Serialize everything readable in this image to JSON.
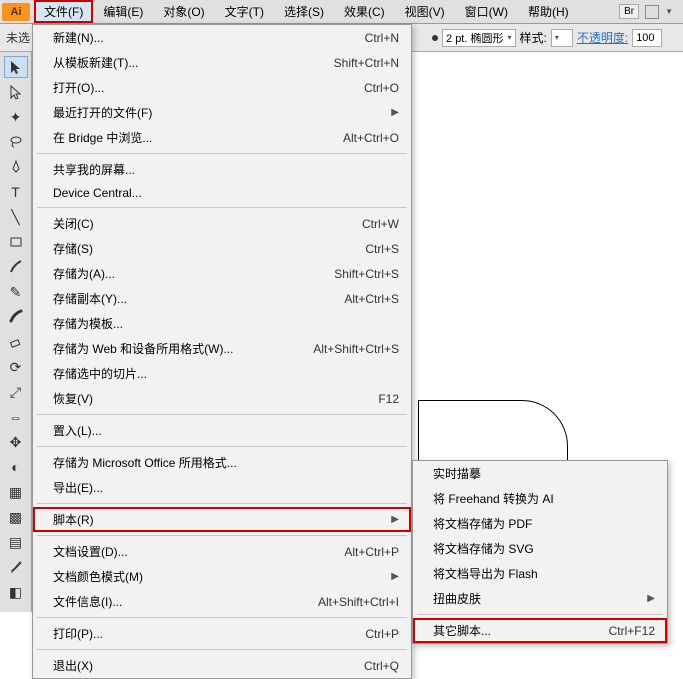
{
  "app_badge": "Ai",
  "menubar": {
    "items": [
      "文件(F)",
      "编辑(E)",
      "对象(O)",
      "文字(T)",
      "选择(S)",
      "效果(C)",
      "视图(V)",
      "窗口(W)",
      "帮助(H)"
    ],
    "right_badge": "Br"
  },
  "options": {
    "left_label": "未选",
    "stroke_value": "2 pt. 椭圆形",
    "style_label": "样式:",
    "opacity_label": "不透明度:",
    "opacity_value": "100"
  },
  "file_menu": [
    {
      "label": "新建(N)...",
      "shortcut": "Ctrl+N"
    },
    {
      "label": "从模板新建(T)...",
      "shortcut": "Shift+Ctrl+N"
    },
    {
      "label": "打开(O)...",
      "shortcut": "Ctrl+O"
    },
    {
      "label": "最近打开的文件(F)",
      "sub": true
    },
    {
      "label": "在 Bridge 中浏览...",
      "shortcut": "Alt+Ctrl+O"
    },
    {
      "sep": true
    },
    {
      "label": "共享我的屏幕..."
    },
    {
      "label": "Device Central..."
    },
    {
      "sep": true
    },
    {
      "label": "关闭(C)",
      "shortcut": "Ctrl+W"
    },
    {
      "label": "存储(S)",
      "shortcut": "Ctrl+S"
    },
    {
      "label": "存储为(A)...",
      "shortcut": "Shift+Ctrl+S"
    },
    {
      "label": "存储副本(Y)...",
      "shortcut": "Alt+Ctrl+S"
    },
    {
      "label": "存储为模板..."
    },
    {
      "label": "存储为 Web 和设备所用格式(W)...",
      "shortcut": "Alt+Shift+Ctrl+S"
    },
    {
      "label": "存储选中的切片..."
    },
    {
      "label": "恢复(V)",
      "shortcut": "F12"
    },
    {
      "sep": true
    },
    {
      "label": "置入(L)..."
    },
    {
      "sep": true
    },
    {
      "label": "存储为 Microsoft Office 所用格式..."
    },
    {
      "label": "导出(E)..."
    },
    {
      "sep": true
    },
    {
      "label": "脚本(R)",
      "sub": true,
      "hl": true
    },
    {
      "sep": true
    },
    {
      "label": "文档设置(D)...",
      "shortcut": "Alt+Ctrl+P"
    },
    {
      "label": "文档颜色模式(M)",
      "sub": true
    },
    {
      "label": "文件信息(I)...",
      "shortcut": "Alt+Shift+Ctrl+I"
    },
    {
      "sep": true
    },
    {
      "label": "打印(P)...",
      "shortcut": "Ctrl+P"
    },
    {
      "sep": true
    },
    {
      "label": "退出(X)",
      "shortcut": "Ctrl+Q"
    }
  ],
  "script_submenu": [
    {
      "label": "实时描摹"
    },
    {
      "label": "将 Freehand 转换为 AI"
    },
    {
      "label": "将文档存储为 PDF"
    },
    {
      "label": "将文档存储为 SVG"
    },
    {
      "label": "将文档导出为 Flash"
    },
    {
      "label": "扭曲皮肤",
      "sub": true
    },
    {
      "sep": true
    },
    {
      "label": "其它脚本...",
      "shortcut": "Ctrl+F12",
      "hl": true
    }
  ]
}
